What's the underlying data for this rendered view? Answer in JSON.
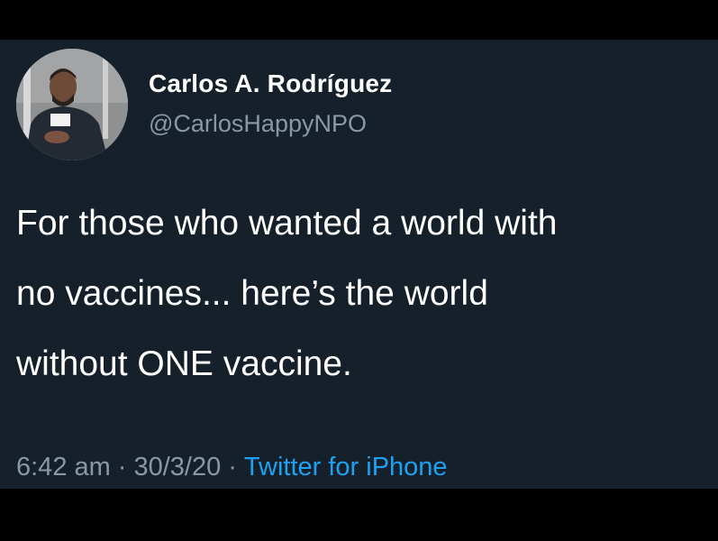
{
  "tweet": {
    "author": {
      "display_name": "Carlos A. Rodríguez",
      "handle": "@CarlosHappyNPO",
      "avatar_icon": "profile-photo"
    },
    "text_lines": [
      "For those who wanted a world with",
      "no vaccines... here’s the world",
      "without ONE vaccine."
    ],
    "meta": {
      "time": "6:42 am",
      "separator": "·",
      "date": "30/3/20",
      "source": "Twitter for iPhone"
    }
  },
  "colors": {
    "background": "#15202b",
    "letterbox": "#000000",
    "text_primary": "#ffffff",
    "text_secondary": "#8899a6",
    "link": "#1da1f2"
  }
}
